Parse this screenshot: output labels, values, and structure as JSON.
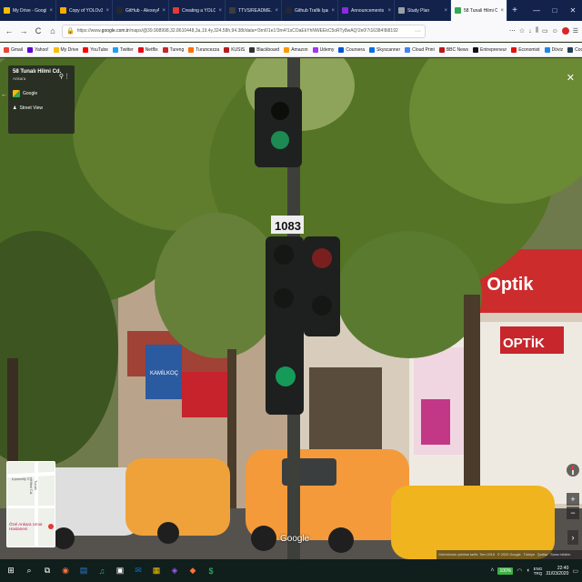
{
  "tabs": [
    {
      "label": "My Drive - Google D...",
      "color": "#fbbc05"
    },
    {
      "label": "Copy of YOLOv3_Tu...",
      "color": "#f9ab00"
    },
    {
      "label": "GitHub - AlexeyAB/Yolo...",
      "color": "#24292e"
    },
    {
      "label": "Creating a YOLOv3 ...",
      "color": "#e53935"
    },
    {
      "label": "TTVS/README.md a...",
      "color": "#3d3d3d"
    },
    {
      "label": "Github Trafik Işareti...",
      "color": "#24292e"
    },
    {
      "label": "Announcements - E...",
      "color": "#8a2be2"
    },
    {
      "label": "Study Plan",
      "color": "#9aa0a6"
    },
    {
      "label": "58 Tunali Hilmi Cd...",
      "color": "#34a853"
    }
  ],
  "close_glyph": "×",
  "new_tab_glyph": "+",
  "window_controls": [
    "—",
    "□",
    "✕"
  ],
  "nav": {
    "back": "←",
    "forward": "→",
    "reload": "C",
    "home": "⌂",
    "lock": "🔒",
    "url_prefix": "https://www.",
    "url_domain": "google.com.tr",
    "url_rest": "/maps/@39.908998,32.8610448,3a,19.4y,324.58h,94.38t/data=!3m6!1e1!3m4!1sCOaEkYhNWEEkC5oRTy8wAQ!2e0!7i16384!8i8192",
    "more": "···",
    "icons": [
      "⋯",
      "☆",
      "↓",
      "⫼",
      "▭",
      "☺",
      "☰"
    ]
  },
  "bookmarks": [
    {
      "label": "Gmail",
      "color": "#ea4335"
    },
    {
      "label": "Yahoo!",
      "color": "#6001d2"
    },
    {
      "label": "My Drive",
      "color": "#fbbc05"
    },
    {
      "label": "YouTube",
      "color": "#ff0000"
    },
    {
      "label": "Twitter",
      "color": "#1da1f2"
    },
    {
      "label": "Netflix",
      "color": "#e50914"
    },
    {
      "label": "Tureng",
      "color": "#c62828"
    },
    {
      "label": "Turuncezza",
      "color": "#ff6f00"
    },
    {
      "label": "KUSIS",
      "color": "#b71c1c"
    },
    {
      "label": "Blackboard",
      "color": "#333333"
    },
    {
      "label": "Amazon",
      "color": "#ff9900"
    },
    {
      "label": "Udemy",
      "color": "#a435f0"
    },
    {
      "label": "Coursera",
      "color": "#0056d2"
    },
    {
      "label": "Skyscanner",
      "color": "#0770e3"
    },
    {
      "label": "Cloud Print",
      "color": "#4285f4"
    },
    {
      "label": "BBC News",
      "color": "#bb1919"
    },
    {
      "label": "Entrepreneur",
      "color": "#111111"
    },
    {
      "label": "Economist",
      "color": "#e3120b"
    },
    {
      "label": "Döviz",
      "color": "#1e88e5"
    },
    {
      "label": "Codecademy",
      "color": "#1f4056"
    },
    {
      "label": "documentary",
      "color": "#222222"
    }
  ],
  "streetview": {
    "place_title": "58 Tunalı Hilmi Cd.",
    "city": "Ankara",
    "brand_label": "Google",
    "street_view_label": "Street View",
    "pin_icon": "⚲",
    "more_icon": "⋮",
    "back_icon": "←",
    "close_icon": "✕",
    "zoom_in": "+",
    "zoom_out": "−",
    "next_icon": "›",
    "map_street": "Kennedy Cd.",
    "map_street2": "Tunalı Hilmi Cd.",
    "map_poi": "Özel Ankara Umut Hastanesi",
    "watermark": "Google",
    "footer": [
      "Görüntünün çekilme tarihi: Tem 2019",
      "© 2020 Google",
      "Türkiye",
      "Şartlar",
      "Sorun bildirin"
    ],
    "signs": {
      "pole_number": "1083",
      "kamilkoc": "KAMİLKOÇ",
      "optik_big": "...a & Optik",
      "optik_small": "OPTİK"
    }
  },
  "taskbar": {
    "start_icon": "⊞",
    "icons": [
      {
        "glyph": "⌕",
        "color": "#ffffff"
      },
      {
        "glyph": "⧉",
        "color": "#ffffff"
      },
      {
        "glyph": "◉",
        "color": "#ff7139"
      },
      {
        "glyph": "▤",
        "color": "#2b7cd3"
      },
      {
        "glyph": "♫",
        "color": "#1db954"
      },
      {
        "glyph": "▣",
        "color": "#ffffff"
      },
      {
        "glyph": "✉",
        "color": "#0078d4"
      },
      {
        "glyph": "▦",
        "color": "#f3c300"
      },
      {
        "glyph": "◈",
        "color": "#a259ff"
      },
      {
        "glyph": "◆",
        "color": "#ff7139"
      },
      {
        "glyph": "$",
        "color": "#2ecc71"
      }
    ],
    "battery": "100%",
    "lang_top": "ENG",
    "lang_bottom": "TRQ",
    "time": "22:40",
    "date": "31/03/2020",
    "notif_icon": "▭"
  }
}
